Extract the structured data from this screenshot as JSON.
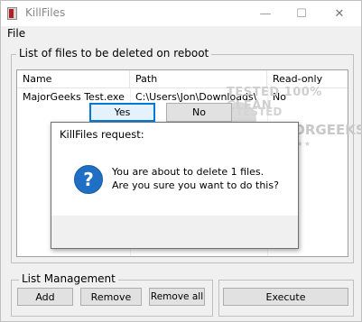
{
  "window": {
    "title": "KillFiles"
  },
  "menu": {
    "file": "File"
  },
  "list_group": {
    "title": "List of files to be deleted on reboot",
    "columns": [
      "Name",
      "Path",
      "Read-only"
    ],
    "rows": [
      {
        "name": "MajorGeeks Test.exe",
        "path": "C:\\Users\\Jon\\Downloads\\",
        "readonly": "No"
      }
    ]
  },
  "watermark": {
    "line1": "TESTED 100% CLEAN",
    "line2": "TESTED",
    "line3": "MAJORGEEKS",
    "stars": "★★★★★"
  },
  "list_management": {
    "title": "List Management",
    "add": "Add",
    "remove": "Remove",
    "remove_all": "Remove all"
  },
  "execute": "Execute",
  "dialog": {
    "title": "KillFiles request:",
    "message1": "You are about to delete 1 files.",
    "message2": "Are you sure you want to do this?",
    "yes": "Yes",
    "no": "No"
  }
}
